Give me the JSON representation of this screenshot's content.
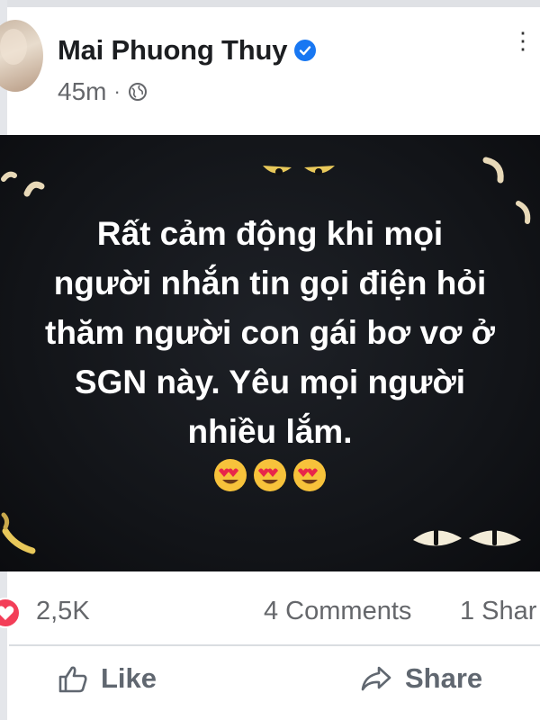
{
  "post": {
    "author": "Mai Phuong Thuy",
    "time": "45m",
    "separator": "·",
    "text_lines": [
      "Rất cảm động khi mọi",
      "người nhắn tin gọi điện hỏi",
      "thăm người con gái bơ vơ ở",
      "SGN này. Yêu mọi người",
      "nhiều lắm."
    ],
    "emojis": [
      "heart-eyes-emoji",
      "heart-eyes-emoji",
      "heart-eyes-emoji"
    ],
    "background_color": "#101216"
  },
  "stats": {
    "reactions": "2,5K",
    "comments": "4 Comments",
    "shares": "1 Shar"
  },
  "actions": {
    "like_label": "Like",
    "share_label": "Share"
  },
  "colors": {
    "verified": "#1877f2",
    "secondary_text": "#65676b",
    "love_reaction": "#f33e58"
  }
}
